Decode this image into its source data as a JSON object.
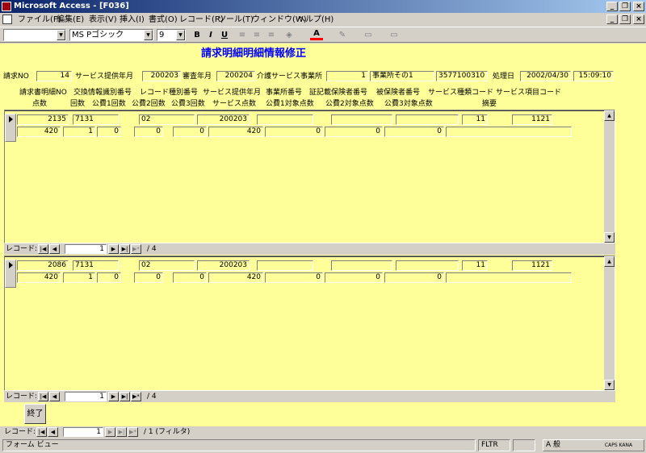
{
  "window": {
    "title": "Microsoft Access - [F036]",
    "min": "_",
    "restore": "❐",
    "close": "×"
  },
  "menu": [
    {
      "label": "ファイル(F)"
    },
    {
      "label": "編集(E)"
    },
    {
      "label": "表示(V)"
    },
    {
      "label": "挿入(I)"
    },
    {
      "label": "書式(O)"
    },
    {
      "label": "レコード(R)"
    },
    {
      "label": "ツール(T)"
    },
    {
      "label": "ウィンドウ(W)"
    },
    {
      "label": "ヘルプ(H)"
    }
  ],
  "toolbar": {
    "font_name": "MS Pゴシック",
    "font_size": "9",
    "bold": "B",
    "italic": "I",
    "underline": "U",
    "font_color": "A"
  },
  "form": {
    "title": "請求明細明細情報修正",
    "header": {
      "seikyu_no_label": "請求NO",
      "seikyu_no": "14",
      "service_ym_label": "サービス提供年月",
      "service_ym": "200203",
      "shinsa_ym_label": "審査年月",
      "shinsa_ym": "200204",
      "jigyosho_label": "介護サービス事業所",
      "jigyosho_no": "1",
      "jigyosho_name": "事業所その1",
      "jigyosho_code": "3577100310",
      "shori_label": "処理日",
      "shori_date": "2002/04/30",
      "shori_time": "15:09:10"
    },
    "col_headers_row1": [
      "請求書明細NO",
      "交換情報識別番号",
      "レコード種別番号",
      "サービス提供年月",
      "事業所番号",
      "証記載保険者番号",
      "被保険者番号",
      "サービス種類コード",
      "サービス項目コード"
    ],
    "col_headers_row2": [
      "点数",
      "回数",
      "公費1回数",
      "公費2回数",
      "公費3回数",
      "サービス点数",
      "公費1対象点数",
      "公費2対象点数",
      "公費3対象点数",
      "摘要"
    ],
    "sub1": {
      "row1": [
        "2135",
        "7131",
        "02",
        "200203",
        "",
        "",
        "",
        "11",
        "1121"
      ],
      "row2": [
        "420",
        "1",
        "0",
        "0",
        "0",
        "420",
        "0",
        "0",
        "0",
        ""
      ],
      "nav_label": "レコード:",
      "current": "1",
      "total": "/ 4"
    },
    "sub2": {
      "row1": [
        "2086",
        "7131",
        "02",
        "200203",
        "",
        "",
        "",
        "11",
        "1121"
      ],
      "row2": [
        "420",
        "1",
        "0",
        "0",
        "0",
        "420",
        "0",
        "0",
        "0",
        ""
      ],
      "nav_label": "レコード:",
      "current": "1",
      "total": "/ 4"
    },
    "close_button": "終了",
    "main_nav": {
      "label": "レコード:",
      "current": "1",
      "total": "/ 1 (フィルタ)"
    }
  },
  "nav_icons": {
    "first": "|◀",
    "prev": "◀",
    "next": "▶",
    "last": "▶|",
    "new": "▶*"
  },
  "status": {
    "left": "フォーム ビュー",
    "fltr": "FLTR",
    "ime": "A 般",
    "caps": "CAPS KANA"
  }
}
